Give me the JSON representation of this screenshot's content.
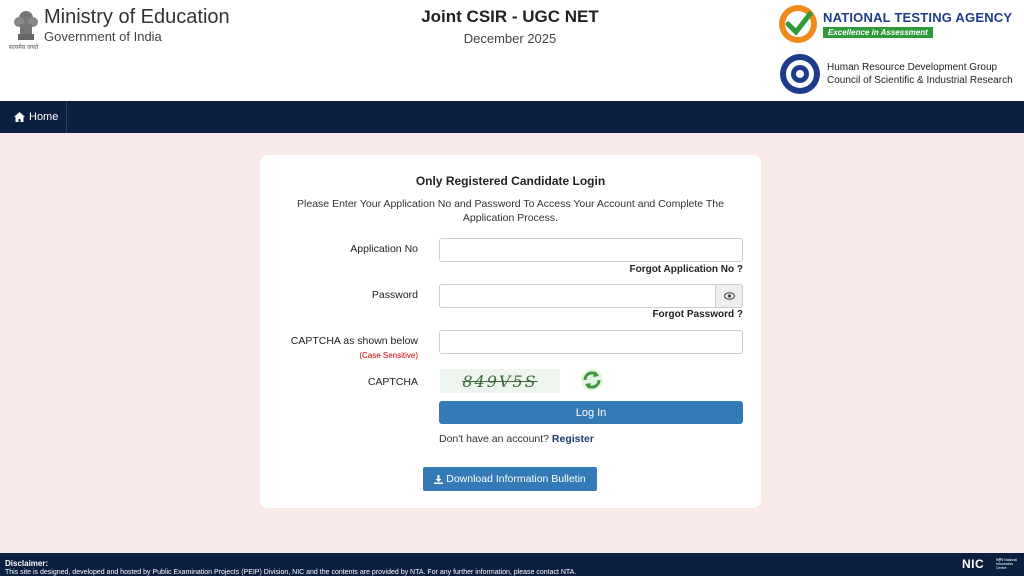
{
  "header": {
    "ministry_title": "Ministry of Education",
    "ministry_sub": "Government of India",
    "emblem_caption": "सत्यमेव जयते",
    "exam_title": "Joint CSIR - UGC NET",
    "exam_session": "December 2025",
    "nta_name": "NATIONAL TESTING AGENCY",
    "nta_tagline": "Excellence in Assessment",
    "csir_line1": "Human Resource Development Group",
    "csir_line2": "Council of Scientific & Industrial Research"
  },
  "nav": {
    "home_label": "Home"
  },
  "login": {
    "title": "Only Registered Candidate Login",
    "description": "Please Enter Your Application No and Password To Access Your Account and Complete The Application Process.",
    "app_no_label": "Application No",
    "app_no_value": "",
    "forgot_app_no": "Forgot Application No ?",
    "password_label": "Password",
    "password_value": "",
    "forgot_password": "Forgot Password ?",
    "captcha_input_label": "CAPTCHA as shown below",
    "case_sensitive": "(Case Sensitive)",
    "captcha_value": "",
    "captcha_label": "CAPTCHA",
    "captcha_text": "849V5S",
    "login_button": "Log In",
    "no_account_text": "Don't have an account?",
    "register_link": "Register",
    "download_button": "Download Information Bulletin"
  },
  "footer": {
    "disclaimer_title": "Disclaimer:",
    "disclaimer_text": "This site is designed, developed and hosted by Public Examination Projects (PEIP) Division, NIC and the contents are provided by NTA. For any further information, please contact NTA.",
    "nic_label": "NIC",
    "nic_sub": "राष्ट्रीय National Informatics Centre"
  },
  "colors": {
    "navbar": "#0b1f3f",
    "page_bg": "#fbeaea",
    "primary_button": "#337ab7",
    "nta_green": "#2f9a3a",
    "nta_blue": "#1f3b8b"
  },
  "icons": {
    "home": "home-icon",
    "eye": "eye-icon",
    "refresh": "refresh-captcha-icon",
    "download": "download-icon"
  }
}
